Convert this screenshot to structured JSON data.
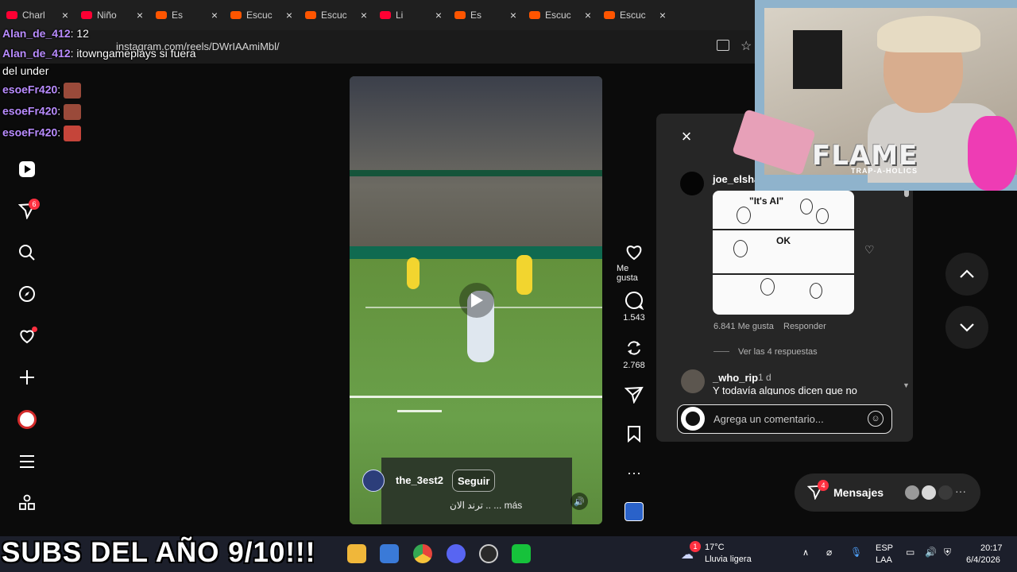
{
  "browser": {
    "tabs": [
      {
        "label": "Charl",
        "color": "#ff0033"
      },
      {
        "label": "Niño",
        "color": "#ff0033"
      },
      {
        "label": "Es",
        "color": "#ff5500"
      },
      {
        "label": "Escuc",
        "color": "#ff5500"
      },
      {
        "label": "Escuc",
        "color": "#ff5500"
      },
      {
        "label": "Li",
        "color": "#ff0033"
      },
      {
        "label": "Es",
        "color": "#ff5500"
      },
      {
        "label": "Escuc",
        "color": "#ff5500"
      },
      {
        "label": "Escuc",
        "color": "#ff5500"
      }
    ],
    "close_glyph": "×",
    "url": "instagram.com/reels/DWrIAAmiMbl/"
  },
  "chat": [
    {
      "user": "Alan_de_412",
      "text": ": 12"
    },
    {
      "user": "Alan_de_412",
      "text": ": itowngameplays si fuera"
    },
    {
      "user": "",
      "text": "del under"
    },
    {
      "user": "esoeFr420",
      "text": ":"
    },
    {
      "user": "esoeFr420",
      "text": ":"
    },
    {
      "user": "esoeFr420",
      "text": ":"
    }
  ],
  "sidebar": {
    "notifications_badge": "6",
    "icons": [
      "reels-icon",
      "direct-icon",
      "search-icon",
      "explore-icon",
      "heart-icon",
      "create-icon",
      "profile-icon",
      "menu-icon",
      "apps-icon"
    ]
  },
  "reel": {
    "creator": "the_3est2",
    "follow_label": "Seguir",
    "caption": "ترند الان .. ... más",
    "likes_label": "Me gusta",
    "comments_count": "1.543",
    "reposts_count": "2.768",
    "more_glyph": "···"
  },
  "comments": {
    "comment1": {
      "user": "joe_elshabasy",
      "meme_top_text": "\"It's AI\"",
      "meme_mid_text": "OK",
      "likes": "6.841 Me gusta",
      "reply_label": "Responder",
      "view_replies": "Ver las 4 respuestas"
    },
    "comment2": {
      "user": "_who_rip",
      "time": "1 d",
      "text": "Y todavía algunos dicen que no"
    },
    "input_placeholder": "Agrega un comentario..."
  },
  "messages": {
    "label": "Mensajes",
    "badge": "4"
  },
  "stream_overlay": {
    "flame_title": "FLAME",
    "flame_subtitle": "TRAP-A-HOLICS",
    "subs_banner": "SUBS DEL AÑO 9/10!!!"
  },
  "taskbar": {
    "weather_badge": "1",
    "temperature": "17°C",
    "weather": "Lluvia ligera",
    "lang1": "ESP",
    "lang2": "LAA",
    "time": "20:17",
    "date": "6/4/2026"
  }
}
